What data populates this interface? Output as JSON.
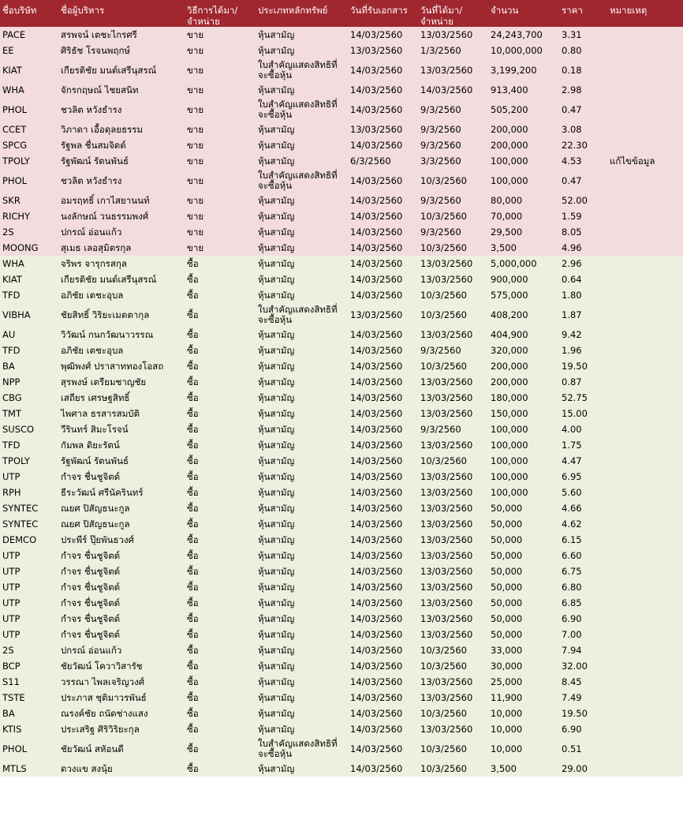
{
  "headers": [
    "ชื่อบริษัท",
    "ชื่อผู้บริหาร",
    "วิธีการได้มา/จำหน่าย",
    "ประเภทหลักทรัพย์",
    "วันที่รับเอกสาร",
    "วันที่ได้มา/จำหน่าย",
    "จำนวน",
    "ราคา",
    "หมายเหตุ"
  ],
  "colors": {
    "header": "#a0262f",
    "sell_row": "#f2dcdd",
    "buy_row": "#ebf1de"
  },
  "rows": [
    {
      "type": "sell",
      "c": [
        "PACE",
        "สรพจน์ เตชะไกรศรี",
        "ขาย",
        "หุ้นสามัญ",
        "14/03/2560",
        "13/03/2560",
        "24,243,700",
        "3.31",
        ""
      ]
    },
    {
      "type": "sell",
      "c": [
        "EE",
        "ศิริธัช โรจนพฤกษ์",
        "ขาย",
        "หุ้นสามัญ",
        "13/03/2560",
        "1/3/2560",
        "10,000,000",
        "0.80",
        ""
      ]
    },
    {
      "type": "sell",
      "tall": true,
      "c": [
        "KIAT",
        "เกียรติชัย มนต์เสรีนุสรณ์",
        "ขาย",
        "ใบสำคัญแสดงสิทธิที่จะซื้อหุ้น",
        "14/03/2560",
        "13/03/2560",
        "3,199,200",
        "0.18",
        ""
      ]
    },
    {
      "type": "sell",
      "c": [
        "WHA",
        "จักรกฤษณ์ ไชยสนิท",
        "ขาย",
        "หุ้นสามัญ",
        "14/03/2560",
        "14/03/2560",
        "913,400",
        "2.98",
        ""
      ]
    },
    {
      "type": "sell",
      "tall": true,
      "c": [
        "PHOL",
        "ชวลิต หวังธำรง",
        "ขาย",
        "ใบสำคัญแสดงสิทธิที่จะซื้อหุ้น",
        "14/03/2560",
        "9/3/2560",
        "505,200",
        "0.47",
        ""
      ]
    },
    {
      "type": "sell",
      "c": [
        "CCET",
        "วิภาดา เอื้อดุลยธรรม",
        "ขาย",
        "หุ้นสามัญ",
        "13/03/2560",
        "9/3/2560",
        "200,000",
        "3.08",
        ""
      ]
    },
    {
      "type": "sell",
      "c": [
        "SPCG",
        "รัฐพล ชื่นสมจิตต์",
        "ขาย",
        "หุ้นสามัญ",
        "14/03/2560",
        "9/3/2560",
        "200,000",
        "22.30",
        ""
      ]
    },
    {
      "type": "sell",
      "c": [
        "TPOLY",
        "รัฐพัฒน์ รัตนพันธ์",
        "ขาย",
        "หุ้นสามัญ",
        "6/3/2560",
        "3/3/2560",
        "100,000",
        "4.53",
        "แก้ไขข้อมูล"
      ]
    },
    {
      "type": "sell",
      "tall": true,
      "c": [
        "PHOL",
        "ชวลิต หวังธำรง",
        "ขาย",
        "ใบสำคัญแสดงสิทธิที่จะซื้อหุ้น",
        "14/03/2560",
        "10/3/2560",
        "100,000",
        "0.47",
        ""
      ]
    },
    {
      "type": "sell",
      "c": [
        "SKR",
        "อมรฤทธิ์ เกาไสยานนท์",
        "ขาย",
        "หุ้นสามัญ",
        "14/03/2560",
        "9/3/2560",
        "80,000",
        "52.00",
        ""
      ]
    },
    {
      "type": "sell",
      "c": [
        "RICHY",
        "นงลักษณ์ วนธรรมพงศ์",
        "ขาย",
        "หุ้นสามัญ",
        "14/03/2560",
        "10/3/2560",
        "70,000",
        "1.59",
        ""
      ]
    },
    {
      "type": "sell",
      "c": [
        "2S",
        "ปกรณ์ อ่อนแก้ว",
        "ขาย",
        "หุ้นสามัญ",
        "14/03/2560",
        "9/3/2560",
        "29,500",
        "8.05",
        ""
      ]
    },
    {
      "type": "sell",
      "c": [
        "MOONG",
        "สุเมธ เลอสุมิตรกุล",
        "ขาย",
        "หุ้นสามัญ",
        "14/03/2560",
        "10/3/2560",
        "3,500",
        "4.96",
        ""
      ]
    },
    {
      "type": "buy",
      "c": [
        "WHA",
        "จริพร จารุกรสกุล",
        "ซื้อ",
        "หุ้นสามัญ",
        "14/03/2560",
        "13/03/2560",
        "5,000,000",
        "2.96",
        ""
      ]
    },
    {
      "type": "buy",
      "c": [
        "KIAT",
        "เกียรติชัย มนต์เสรีนุสรณ์",
        "ซื้อ",
        "หุ้นสามัญ",
        "14/03/2560",
        "13/03/2560",
        "900,000",
        "0.64",
        ""
      ]
    },
    {
      "type": "buy",
      "c": [
        "TFD",
        "อภิชัย เตชะอุบล",
        "ซื้อ",
        "หุ้นสามัญ",
        "14/03/2560",
        "10/3/2560",
        "575,000",
        "1.80",
        ""
      ]
    },
    {
      "type": "buy",
      "tall": true,
      "c": [
        "VIBHA",
        "ชัยสิทธิ์ วิริยะเมตตากุล",
        "ซื้อ",
        "ใบสำคัญแสดงสิทธิที่จะซื้อหุ้น",
        "13/03/2560",
        "10/3/2560",
        "408,200",
        "1.87",
        ""
      ]
    },
    {
      "type": "buy",
      "c": [
        "AU",
        "วิวัฒน์ กนกวัฒนาวรรณ",
        "ซื้อ",
        "หุ้นสามัญ",
        "14/03/2560",
        "13/03/2560",
        "404,900",
        "9.42",
        ""
      ]
    },
    {
      "type": "buy",
      "c": [
        "TFD",
        "อภิชัย เตชะอุบล",
        "ซื้อ",
        "หุ้นสามัญ",
        "14/03/2560",
        "9/3/2560",
        "320,000",
        "1.96",
        ""
      ]
    },
    {
      "type": "buy",
      "c": [
        "BA",
        "พุฒิพงศ์ ปราสาททองโอสถ",
        "ซื้อ",
        "หุ้นสามัญ",
        "14/03/2560",
        "10/3/2560",
        "200,000",
        "19.50",
        ""
      ]
    },
    {
      "type": "buy",
      "c": [
        "NPP",
        "สุรพงษ์ เตรียมชาญชัย",
        "ซื้อ",
        "หุ้นสามัญ",
        "14/03/2560",
        "13/03/2560",
        "200,000",
        "0.87",
        ""
      ]
    },
    {
      "type": "buy",
      "c": [
        "CBG",
        "เสถียร เศรษฐสิทธิ์",
        "ซื้อ",
        "หุ้นสามัญ",
        "14/03/2560",
        "13/03/2560",
        "180,000",
        "52.75",
        ""
      ]
    },
    {
      "type": "buy",
      "c": [
        "TMT",
        "ไพศาล ธรสารสมบัติ",
        "ซื้อ",
        "หุ้นสามัญ",
        "14/03/2560",
        "13/03/2560",
        "150,000",
        "15.00",
        ""
      ]
    },
    {
      "type": "buy",
      "c": [
        "SUSCO",
        "วีรินทร์ สิมะโรจน์",
        "ซื้อ",
        "หุ้นสามัญ",
        "14/03/2560",
        "9/3/2560",
        "100,000",
        "4.00",
        ""
      ]
    },
    {
      "type": "buy",
      "c": [
        "TFD",
        "กัมพล ดิยะรัตน์",
        "ซื้อ",
        "หุ้นสามัญ",
        "14/03/2560",
        "13/03/2560",
        "100,000",
        "1.75",
        ""
      ]
    },
    {
      "type": "buy",
      "c": [
        "TPOLY",
        "รัฐพัฒน์ รัตนพันธ์",
        "ซื้อ",
        "หุ้นสามัญ",
        "14/03/2560",
        "10/3/2560",
        "100,000",
        "4.47",
        ""
      ]
    },
    {
      "type": "buy",
      "c": [
        "UTP",
        "กำจร ชื่นชูจิตต์",
        "ซื้อ",
        "หุ้นสามัญ",
        "14/03/2560",
        "13/03/2560",
        "100,000",
        "6.95",
        ""
      ]
    },
    {
      "type": "buy",
      "c": [
        "RPH",
        "ธีระวัฒน์ ศรีนัครินทร์",
        "ซื้อ",
        "หุ้นสามัญ",
        "14/03/2560",
        "13/03/2560",
        "100,000",
        "5.60",
        ""
      ]
    },
    {
      "type": "buy",
      "c": [
        "SYNTEC",
        "ณยศ ปิสัญธนะกูล",
        "ซื้อ",
        "หุ้นสามัญ",
        "14/03/2560",
        "13/03/2560",
        "50,000",
        "4.66",
        ""
      ]
    },
    {
      "type": "buy",
      "c": [
        "SYNTEC",
        "ณยศ ปิสัญธนะกูล",
        "ซื้อ",
        "หุ้นสามัญ",
        "14/03/2560",
        "13/03/2560",
        "50,000",
        "4.62",
        ""
      ]
    },
    {
      "type": "buy",
      "c": [
        "DEMCO",
        "ประพีร์ ปุ๊ยพันธวงศ์",
        "ซื้อ",
        "หุ้นสามัญ",
        "14/03/2560",
        "13/03/2560",
        "50,000",
        "6.15",
        ""
      ]
    },
    {
      "type": "buy",
      "c": [
        "UTP",
        "กำจร ชื่นชูจิตต์",
        "ซื้อ",
        "หุ้นสามัญ",
        "14/03/2560",
        "13/03/2560",
        "50,000",
        "6.60",
        ""
      ]
    },
    {
      "type": "buy",
      "c": [
        "UTP",
        "กำจร ชื่นชูจิตต์",
        "ซื้อ",
        "หุ้นสามัญ",
        "14/03/2560",
        "13/03/2560",
        "50,000",
        "6.75",
        ""
      ]
    },
    {
      "type": "buy",
      "c": [
        "UTP",
        "กำจร ชื่นชูจิตต์",
        "ซื้อ",
        "หุ้นสามัญ",
        "14/03/2560",
        "13/03/2560",
        "50,000",
        "6.80",
        ""
      ]
    },
    {
      "type": "buy",
      "c": [
        "UTP",
        "กำจร ชื่นชูจิตต์",
        "ซื้อ",
        "หุ้นสามัญ",
        "14/03/2560",
        "13/03/2560",
        "50,000",
        "6.85",
        ""
      ]
    },
    {
      "type": "buy",
      "c": [
        "UTP",
        "กำจร ชื่นชูจิตต์",
        "ซื้อ",
        "หุ้นสามัญ",
        "14/03/2560",
        "13/03/2560",
        "50,000",
        "6.90",
        ""
      ]
    },
    {
      "type": "buy",
      "c": [
        "UTP",
        "กำจร ชื่นชูจิตต์",
        "ซื้อ",
        "หุ้นสามัญ",
        "14/03/2560",
        "13/03/2560",
        "50,000",
        "7.00",
        ""
      ]
    },
    {
      "type": "buy",
      "c": [
        "2S",
        "ปกรณ์ อ่อนแก้ว",
        "ซื้อ",
        "หุ้นสามัญ",
        "14/03/2560",
        "10/3/2560",
        "33,000",
        "7.94",
        ""
      ]
    },
    {
      "type": "buy",
      "c": [
        "BCP",
        "ชัยวัฒน์ โควาวิสารัช",
        "ซื้อ",
        "หุ้นสามัญ",
        "14/03/2560",
        "10/3/2560",
        "30,000",
        "32.00",
        ""
      ]
    },
    {
      "type": "buy",
      "c": [
        "S11",
        "วรรณา ไพลเจริญวงศ์",
        "ซื้อ",
        "หุ้นสามัญ",
        "14/03/2560",
        "13/03/2560",
        "25,000",
        "8.45",
        ""
      ]
    },
    {
      "type": "buy",
      "c": [
        "TSTE",
        "ประภาส ชุติมาวรพันธ์",
        "ซื้อ",
        "หุ้นสามัญ",
        "14/03/2560",
        "13/03/2560",
        "11,900",
        "7.49",
        ""
      ]
    },
    {
      "type": "buy",
      "c": [
        "BA",
        "ณรงค์ชัย ถนัดช่างแสง",
        "ซื้อ",
        "หุ้นสามัญ",
        "14/03/2560",
        "10/3/2560",
        "10,000",
        "19.50",
        ""
      ]
    },
    {
      "type": "buy",
      "c": [
        "KTIS",
        "ประเสริฐ ศิริวิริยะกุล",
        "ซื้อ",
        "หุ้นสามัญ",
        "14/03/2560",
        "13/03/2560",
        "10,000",
        "6.90",
        ""
      ]
    },
    {
      "type": "buy",
      "tall": true,
      "c": [
        "PHOL",
        "ชัยวัฒน์ สหัอนดี",
        "ซื้อ",
        "ใบสำคัญแสดงสิทธิที่จะซื้อหุ้น",
        "14/03/2560",
        "10/3/2560",
        "10,000",
        "0.51",
        ""
      ]
    },
    {
      "type": "buy",
      "c": [
        "MTLS",
        "ดวงแข สงนุ้ย",
        "ซื้อ",
        "หุ้นสามัญ",
        "14/03/2560",
        "10/3/2560",
        "3,500",
        "29.00",
        ""
      ]
    }
  ]
}
